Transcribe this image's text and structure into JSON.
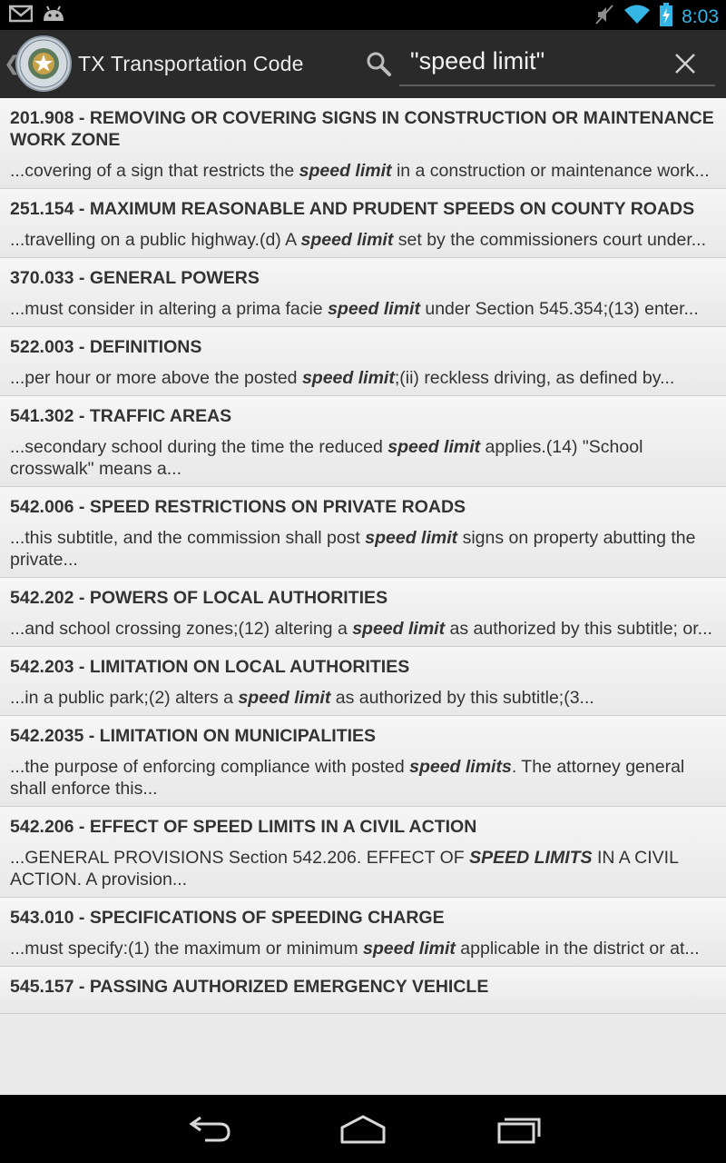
{
  "status_bar": {
    "time": "8:03"
  },
  "action_bar": {
    "title": "TX Transportation Code",
    "search": {
      "value": "\"speed limit\""
    }
  },
  "results": [
    {
      "title": "201.908 - REMOVING OR COVERING SIGNS IN CONSTRUCTION OR MAINTENANCE WORK ZONE",
      "before": "...covering of a sign that restricts the ",
      "highlight": "speed limit",
      "after": " in a construction or maintenance work..."
    },
    {
      "title": "251.154 - MAXIMUM REASONABLE AND PRUDENT SPEEDS ON COUNTY ROADS",
      "before": "...travelling on a public highway.(d) A ",
      "highlight": "speed limit",
      "after": " set by the commissioners court under..."
    },
    {
      "title": "370.033 - GENERAL POWERS",
      "before": "...must consider in altering a prima facie ",
      "highlight": "speed limit",
      "after": " under Section 545.354;(13) enter..."
    },
    {
      "title": "522.003 - DEFINITIONS",
      "before": "...per hour or more above the posted ",
      "highlight": "speed limit",
      "after": ";(ii) reckless driving, as defined by..."
    },
    {
      "title": "541.302 - TRAFFIC AREAS",
      "before": "...secondary school during the time the reduced ",
      "highlight": "speed limit",
      "after": " applies.(14) \"School crosswalk\" means a..."
    },
    {
      "title": "542.006 - SPEED RESTRICTIONS ON PRIVATE ROADS",
      "before": "...this subtitle, and the commission shall post ",
      "highlight": "speed limit",
      "after": " signs on property abutting the private..."
    },
    {
      "title": "542.202 - POWERS OF LOCAL AUTHORITIES",
      "before": "...and school crossing zones;(12) altering a ",
      "highlight": "speed limit",
      "after": " as authorized by this subtitle; or..."
    },
    {
      "title": "542.203 - LIMITATION ON LOCAL AUTHORITIES",
      "before": "...in a public park;(2) alters a ",
      "highlight": "speed limit",
      "after": " as authorized by this subtitle;(3..."
    },
    {
      "title": "542.2035 - LIMITATION ON MUNICIPALITIES",
      "before": "...the purpose of enforcing compliance with posted ",
      "highlight": "speed limits",
      "after": ". The attorney general shall enforce this..."
    },
    {
      "title": "542.206 - EFFECT OF SPEED LIMITS IN A CIVIL ACTION",
      "before": "...GENERAL PROVISIONS Section 542.206. EFFECT OF ",
      "highlight": "SPEED LIMITS",
      "after": " IN A CIVIL ACTION. A provision..."
    },
    {
      "title": "543.010 - SPECIFICATIONS OF SPEEDING CHARGE",
      "before": "...must specify:(1) the maximum or minimum ",
      "highlight": "speed limit",
      "after": " applicable in the district or at..."
    },
    {
      "title": "545.157 - PASSING AUTHORIZED EMERGENCY VEHICLE",
      "before": "",
      "highlight": "",
      "after": ""
    }
  ]
}
